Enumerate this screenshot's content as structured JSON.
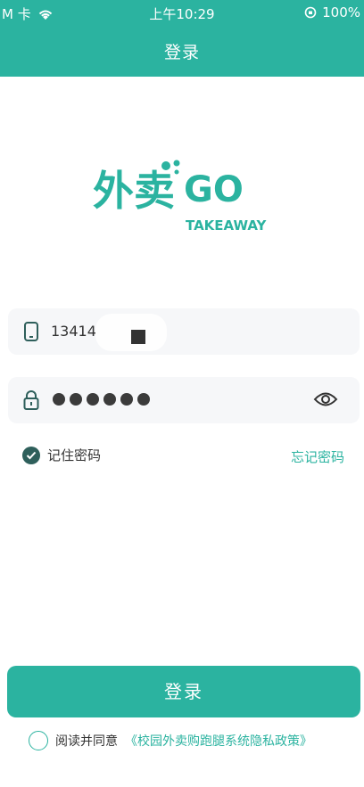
{
  "status_bar": {
    "carrier": "M 卡",
    "time": "上午10:29",
    "battery": "100%"
  },
  "header": {
    "title": "登录"
  },
  "logo": {
    "chinese": "外卖",
    "latin": "GO",
    "sub": "TAKEAWAY"
  },
  "form": {
    "phone_value": "13414",
    "password_dots": 6,
    "remember_label": "记住密码",
    "forgot_label": "忘记密码"
  },
  "actions": {
    "login_label": "登录",
    "agree_prefix": "阅读并同意",
    "agree_link": "《校园外卖购跑腿系统隐私政策》"
  },
  "colors": {
    "brand": "#2bb3a0"
  }
}
